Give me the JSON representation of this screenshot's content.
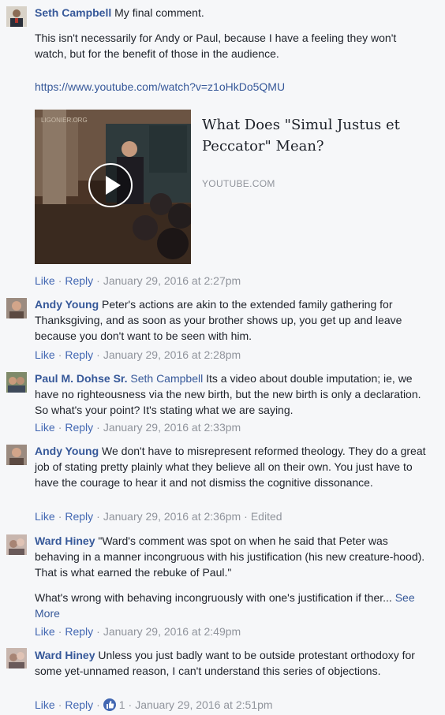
{
  "comments": [
    {
      "author": "Seth Campbell",
      "text": "My final comment.",
      "text2": "This isn't necessarily for Andy or Paul, because I have a feeling they won't watch, but for the benefit of those in the audience.",
      "url": "https://www.youtube.com/watch?v=z1oHkDo5QMU",
      "preview": {
        "title": "What Does \"Simul Justus et Peccator\" Mean?",
        "domain": "YOUTUBE.COM",
        "watermark": "LIGONIER.ORG"
      },
      "like": "Like",
      "reply": "Reply",
      "time": "January 29, 2016 at 2:27pm"
    },
    {
      "author": "Andy Young",
      "text": "Peter's actions are akin to the extended family gathering for Thanksgiving, and as soon as your brother shows up, you get up and leave because you don't want to be seen with him.",
      "like": "Like",
      "reply": "Reply",
      "time": "January 29, 2016 at 2:28pm"
    },
    {
      "author": "Paul M. Dohse Sr.",
      "mention": "Seth Campbell",
      "text": "Its a video about double imputation; ie, we have no righteousness via the new birth, but the new birth is only a declaration. So what's your point? It's stating what we are saying.",
      "like": "Like",
      "reply": "Reply",
      "time": "January 29, 2016 at 2:33pm"
    },
    {
      "author": "Andy Young",
      "text": "We don't have to misrepresent reformed theology. They do a great job of stating pretty plainly what they believe all on their own. You just have to have the courage to hear it and not dismiss the cognitive dissonance.",
      "like": "Like",
      "reply": "Reply",
      "time": "January 29, 2016 at 2:36pm",
      "edited": "Edited"
    },
    {
      "author": "Ward Hiney",
      "text": "\"Ward's comment was spot on when he said that Peter was behaving in a manner incongruous with his justification (his new creature-hood). That is what earned the rebuke of Paul.\"",
      "text2": "What's wrong with behaving incongruously with one's justification if ther...",
      "see_more": "See More",
      "like": "Like",
      "reply": "Reply",
      "time": "January 29, 2016 at 2:49pm"
    },
    {
      "author": "Ward Hiney",
      "text": "Unless you just badly want to be outside protestant orthodoxy for some yet-unnamed reason, I can't understand this series of objections.",
      "like": "Like",
      "reply": "Reply",
      "reactions": "1",
      "time": "January 29, 2016 at 2:51pm"
    }
  ]
}
